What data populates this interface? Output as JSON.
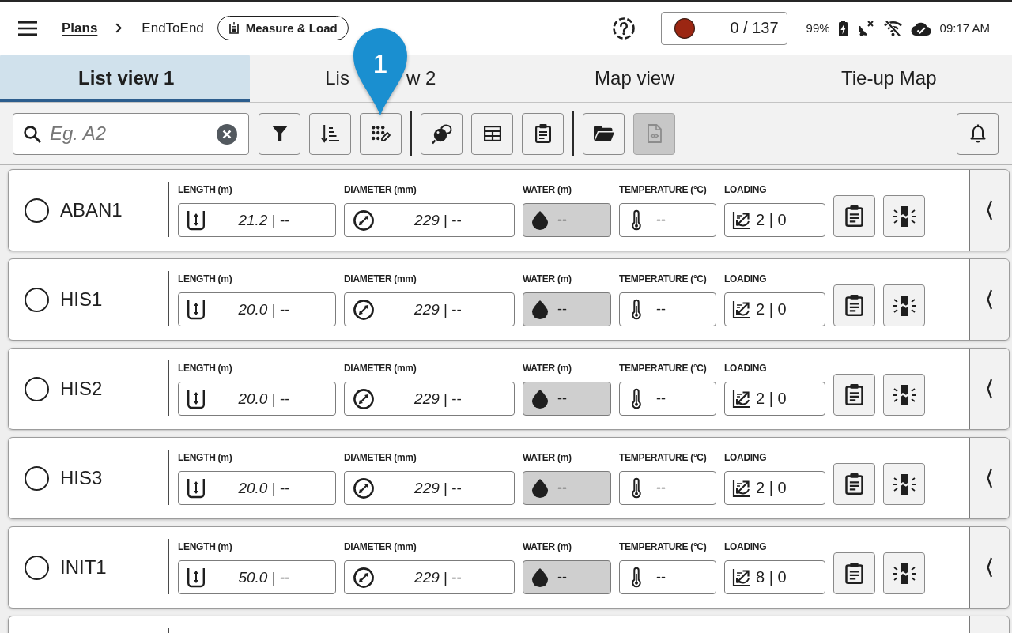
{
  "top_bar": {
    "breadcrumb": {
      "root": "Plans",
      "current": "EndToEnd"
    },
    "mode": "Measure & Load",
    "counter": "0 / 137",
    "battery": "99%",
    "time": "09:17 AM"
  },
  "tabs": [
    {
      "visible_label_parts": [
        "List view 1"
      ],
      "selected": true
    },
    {
      "visible_label_parts": [
        "Lis",
        "w 2"
      ],
      "selected": false
    },
    {
      "visible_label_parts": [
        "Map view"
      ],
      "selected": false
    },
    {
      "visible_label_parts": [
        "Tie-up Map"
      ],
      "selected": false
    }
  ],
  "callout": {
    "label": "1"
  },
  "toolbar": {
    "search": {
      "placeholder": "Eg. A2"
    },
    "groups": [
      [
        {
          "kind": "filter",
          "disabled": false
        },
        {
          "kind": "sort",
          "disabled": false
        },
        {
          "kind": "edit-grid",
          "disabled": false
        }
      ],
      [
        {
          "kind": "ball",
          "disabled": false
        },
        {
          "kind": "table",
          "disabled": false
        },
        {
          "kind": "clipboard",
          "disabled": false
        }
      ],
      [
        {
          "kind": "folder",
          "disabled": false
        },
        {
          "kind": "file-preview",
          "disabled": true
        }
      ]
    ],
    "end": [
      {
        "kind": "bell",
        "disabled": false
      }
    ]
  },
  "rows": [
    {
      "name": "ABAN1",
      "selected": false,
      "fields": [
        {
          "kind": "length",
          "label": "LENGTH (m)",
          "value": "*21.2* | --",
          "disabled": false
        },
        {
          "kind": "diameter",
          "label": "DIAMETER (mm)",
          "value": "*229* | --",
          "disabled": false
        },
        {
          "kind": "water",
          "label": "WATER (m)",
          "value": "--",
          "disabled": true
        },
        {
          "kind": "temperature",
          "label": "TEMPERATURE (°C)",
          "value": "--",
          "disabled": false
        },
        {
          "kind": "loading",
          "label": "LOADING",
          "value": "2 | 0",
          "disabled": false
        }
      ]
    },
    {
      "name": "HIS1",
      "selected": false,
      "fields": [
        {
          "kind": "length",
          "label": "LENGTH (m)",
          "value": "*20.0* | --",
          "disabled": false
        },
        {
          "kind": "diameter",
          "label": "DIAMETER (mm)",
          "value": "*229* | --",
          "disabled": false
        },
        {
          "kind": "water",
          "label": "WATER (m)",
          "value": "--",
          "disabled": true
        },
        {
          "kind": "temperature",
          "label": "TEMPERATURE (°C)",
          "value": "--",
          "disabled": false
        },
        {
          "kind": "loading",
          "label": "LOADING",
          "value": "2 | 0",
          "disabled": false
        }
      ]
    },
    {
      "name": "HIS2",
      "selected": false,
      "fields": [
        {
          "kind": "length",
          "label": "LENGTH (m)",
          "value": "*20.0* | --",
          "disabled": false
        },
        {
          "kind": "diameter",
          "label": "DIAMETER (mm)",
          "value": "*229* | --",
          "disabled": false
        },
        {
          "kind": "water",
          "label": "WATER (m)",
          "value": "--",
          "disabled": true
        },
        {
          "kind": "temperature",
          "label": "TEMPERATURE (°C)",
          "value": "--",
          "disabled": false
        },
        {
          "kind": "loading",
          "label": "LOADING",
          "value": "2 | 0",
          "disabled": false
        }
      ]
    },
    {
      "name": "HIS3",
      "selected": false,
      "fields": [
        {
          "kind": "length",
          "label": "LENGTH (m)",
          "value": "*20.0* | --",
          "disabled": false
        },
        {
          "kind": "diameter",
          "label": "DIAMETER (mm)",
          "value": "*229* | --",
          "disabled": false
        },
        {
          "kind": "water",
          "label": "WATER (m)",
          "value": "--",
          "disabled": true
        },
        {
          "kind": "temperature",
          "label": "TEMPERATURE (°C)",
          "value": "--",
          "disabled": false
        },
        {
          "kind": "loading",
          "label": "LOADING",
          "value": "2 | 0",
          "disabled": false
        }
      ]
    },
    {
      "name": "INIT1",
      "selected": false,
      "fields": [
        {
          "kind": "length",
          "label": "LENGTH (m)",
          "value": "*50.0* | --",
          "disabled": false
        },
        {
          "kind": "diameter",
          "label": "DIAMETER (mm)",
          "value": "*229* | --",
          "disabled": false
        },
        {
          "kind": "water",
          "label": "WATER (m)",
          "value": "--",
          "disabled": true
        },
        {
          "kind": "temperature",
          "label": "TEMPERATURE (°C)",
          "value": "--",
          "disabled": false
        },
        {
          "kind": "loading",
          "label": "LOADING",
          "value": "8 | 0",
          "disabled": false
        }
      ]
    }
  ]
}
